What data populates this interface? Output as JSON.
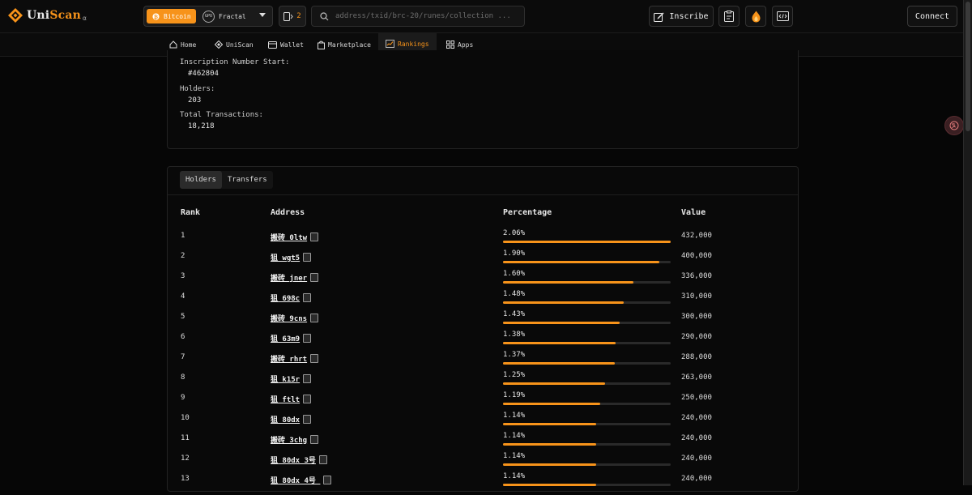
{
  "brand": {
    "name_prefix": "Uni",
    "name_suffix": "Scan",
    "sub": "α"
  },
  "network": {
    "active": "Bitcoin",
    "other": "Fractal",
    "other_icon_text": "GPU"
  },
  "queue_count": "2",
  "search": {
    "placeholder": "address/txid/brc-20/runes/collection ..."
  },
  "header_buttons": {
    "inscribe": "Inscribe",
    "connect": "Connect"
  },
  "nav": [
    {
      "label": "Home",
      "icon": "home-icon"
    },
    {
      "label": "UniScan",
      "icon": "uniscan-icon"
    },
    {
      "label": "Wallet",
      "icon": "wallet-icon"
    },
    {
      "label": "Marketplace",
      "icon": "shopping-bag-icon"
    },
    {
      "label": "Rankings",
      "icon": "chart-icon",
      "active": true
    },
    {
      "label": "Apps",
      "icon": "apps-icon"
    }
  ],
  "info": {
    "inscription_start_label": "Inscription Number Start:",
    "inscription_start_value": "#462804",
    "holders_label": "Holders:",
    "holders_value": "203",
    "transactions_label": "Total Transactions:",
    "transactions_value": "18,218"
  },
  "tabs": [
    "Holders",
    "Transfers"
  ],
  "table": {
    "headers": {
      "rank": "Rank",
      "address": "Address",
      "percentage": "Percentage",
      "value": "Value"
    },
    "rows": [
      {
        "rank": "1",
        "address": "搬砖_0ltw",
        "percentage": "2.06%",
        "fraction": 1.0,
        "value": "432,000"
      },
      {
        "rank": "2",
        "address": "狙_wgt5",
        "percentage": "1.90%",
        "fraction": 0.93,
        "value": "400,000"
      },
      {
        "rank": "3",
        "address": "搬砖_jner",
        "percentage": "1.60%",
        "fraction": 0.78,
        "value": "336,000"
      },
      {
        "rank": "4",
        "address": "狙_698c",
        "percentage": "1.48%",
        "fraction": 0.72,
        "value": "310,000"
      },
      {
        "rank": "5",
        "address": "搬砖_9cns",
        "percentage": "1.43%",
        "fraction": 0.695,
        "value": "300,000"
      },
      {
        "rank": "6",
        "address": "狙_63m9",
        "percentage": "1.38%",
        "fraction": 0.67,
        "value": "290,000"
      },
      {
        "rank": "7",
        "address": "搬砖_rhrt",
        "percentage": "1.37%",
        "fraction": 0.665,
        "value": "288,000"
      },
      {
        "rank": "8",
        "address": "狙_k15r",
        "percentage": "1.25%",
        "fraction": 0.61,
        "value": "263,000"
      },
      {
        "rank": "9",
        "address": "狙_ftlt",
        "percentage": "1.19%",
        "fraction": 0.58,
        "value": "250,000"
      },
      {
        "rank": "10",
        "address": "狙_80dx",
        "percentage": "1.14%",
        "fraction": 0.555,
        "value": "240,000"
      },
      {
        "rank": "11",
        "address": "搬砖_3chg",
        "percentage": "1.14%",
        "fraction": 0.555,
        "value": "240,000"
      },
      {
        "rank": "12",
        "address": "狙_80dx_3号",
        "percentage": "1.14%",
        "fraction": 0.555,
        "value": "240,000"
      },
      {
        "rank": "13",
        "address": "狙_80dx_4号_",
        "percentage": "1.14%",
        "fraction": 0.555,
        "value": "240,000"
      }
    ]
  },
  "colors": {
    "accent": "#f7931a",
    "background": "#060606"
  }
}
